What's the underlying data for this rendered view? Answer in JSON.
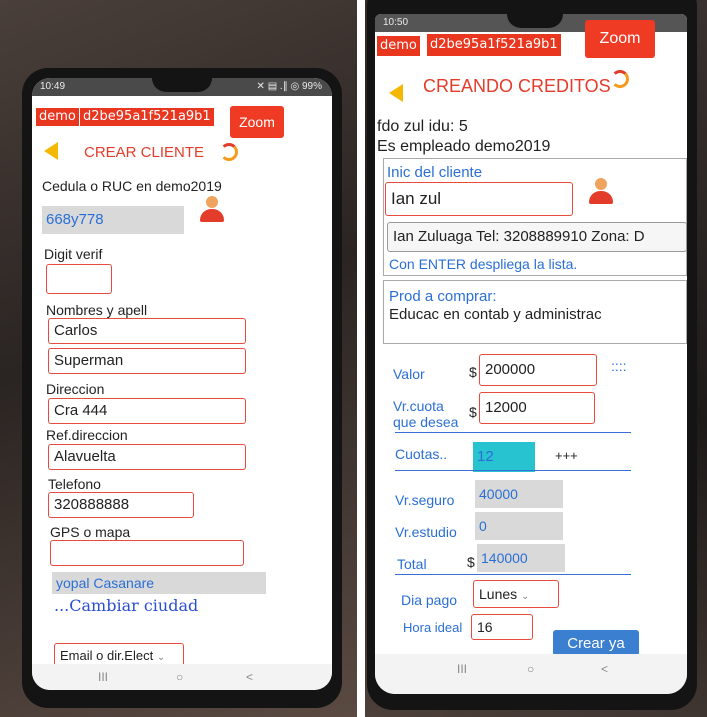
{
  "left": {
    "status": {
      "time": "10:49",
      "icons": "✕ ▤ .∥ ◎ 99%"
    },
    "header": {
      "demo": "demo",
      "id": "d2be95a1f521a9b1",
      "zoom": "Zoom",
      "title": "CREAR CLIENTE"
    },
    "form": {
      "cedula_label": "Cedula o RUC en demo2019",
      "cedula_value": "668y778",
      "digit_label": "Digit verif",
      "digit_value": "",
      "nombres_label": "Nombres y apell",
      "nombre_value": "Carlos",
      "apellido_value": "Superman",
      "direccion_label": "Direccion",
      "direccion_value": "Cra 444",
      "ref_label": "Ref.direccion",
      "ref_value": "Alavuelta",
      "telefono_label": "Telefono",
      "telefono_value": "320888888",
      "gps_label": "GPS o mapa",
      "gps_value": "",
      "ciudad_value": "yopal Casanare",
      "cambiar_ciudad": "...Cambiar ciudad",
      "email_select": "Email o dir.Elect"
    },
    "nav": {
      "recent": "III",
      "home": "○",
      "back": "<"
    }
  },
  "right": {
    "status": {
      "time": "10:50"
    },
    "header": {
      "demo": "demo",
      "id": "d2be95a1f521a9b1",
      "zoom": "Zoom",
      "title": "CREANDO CREDITOS"
    },
    "info": {
      "line1": "fdo zul   idu: 5",
      "line2": "Es empleado  demo2019"
    },
    "cliente": {
      "label": "Inic del cliente",
      "value": "Ian zul",
      "suggestion": "Ian Zuluaga Tel: 3208889910 Zona: D",
      "hint": "Con ENTER despliega la lista."
    },
    "producto": {
      "label": "Prod a comprar:",
      "value": "Educac en contab y administrac"
    },
    "valores": {
      "valor_label": "Valor",
      "currency": "$",
      "valor_value": "200000",
      "dots": "::::",
      "cuota_label_1": "Vr.cuota",
      "cuota_label_2": "que desea",
      "cuota_value": "12000",
      "cuotas_label": "Cuotas..",
      "cuotas_value": "12",
      "plus": "+++",
      "seguro_label": "Vr.seguro",
      "seguro_value": "40000",
      "estudio_label": "Vr.estudio",
      "estudio_value": "0",
      "total_label": "Total",
      "total_value": "140000",
      "dia_label": "Dia pago",
      "dia_value": "Lunes",
      "hora_label": "Hora ideal",
      "hora_value": "16",
      "crear_button": "Crear ya"
    },
    "nav": {
      "recent": "III",
      "home": "○",
      "back": "<"
    }
  },
  "colors": {
    "accent": "#ef3b24",
    "blue": "#2a6fd6",
    "cyan": "#27c3d0"
  }
}
